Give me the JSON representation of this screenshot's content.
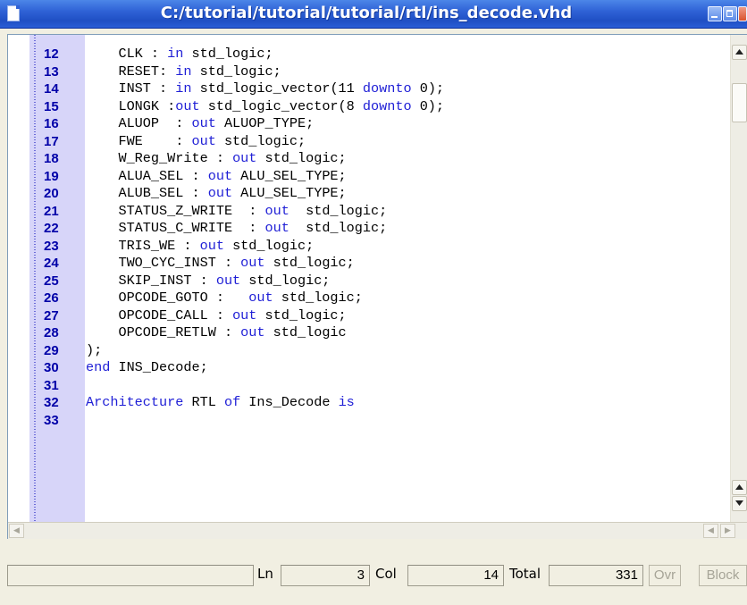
{
  "window": {
    "title": "C:/tutorial/tutorial/tutorial/rtl/ins_decode.vhd"
  },
  "editor": {
    "lines": [
      {
        "n": "12",
        "code": [
          {
            "t": "    CLK : "
          },
          {
            "t": "in",
            "k": 1
          },
          {
            "t": " std_logic;"
          }
        ]
      },
      {
        "n": "13",
        "code": [
          {
            "t": "    RESET: "
          },
          {
            "t": "in",
            "k": 1
          },
          {
            "t": " std_logic;"
          }
        ]
      },
      {
        "n": "14",
        "code": [
          {
            "t": "    INST : "
          },
          {
            "t": "in",
            "k": 1
          },
          {
            "t": " std_logic_vector(11 "
          },
          {
            "t": "downto",
            "k": 1
          },
          {
            "t": " 0);"
          }
        ]
      },
      {
        "n": "15",
        "code": [
          {
            "t": "    LONGK :"
          },
          {
            "t": "out",
            "k": 1
          },
          {
            "t": " std_logic_vector(8 "
          },
          {
            "t": "downto",
            "k": 1
          },
          {
            "t": " 0);"
          }
        ]
      },
      {
        "n": "16",
        "code": [
          {
            "t": "    ALUOP  : "
          },
          {
            "t": "out",
            "k": 1
          },
          {
            "t": " ALUOP_TYPE;"
          }
        ]
      },
      {
        "n": "17",
        "code": [
          {
            "t": "    FWE    : "
          },
          {
            "t": "out",
            "k": 1
          },
          {
            "t": " std_logic;"
          }
        ]
      },
      {
        "n": "18",
        "code": [
          {
            "t": "    W_Reg_Write : "
          },
          {
            "t": "out",
            "k": 1
          },
          {
            "t": " std_logic;"
          }
        ]
      },
      {
        "n": "19",
        "code": [
          {
            "t": "    ALUA_SEL : "
          },
          {
            "t": "out",
            "k": 1
          },
          {
            "t": " ALU_SEL_TYPE;"
          }
        ]
      },
      {
        "n": "20",
        "code": [
          {
            "t": "    ALUB_SEL : "
          },
          {
            "t": "out",
            "k": 1
          },
          {
            "t": " ALU_SEL_TYPE;"
          }
        ]
      },
      {
        "n": "21",
        "code": [
          {
            "t": "    STATUS_Z_WRITE  : "
          },
          {
            "t": "out",
            "k": 1
          },
          {
            "t": "  std_logic;"
          }
        ]
      },
      {
        "n": "22",
        "code": [
          {
            "t": "    STATUS_C_WRITE  : "
          },
          {
            "t": "out",
            "k": 1
          },
          {
            "t": "  std_logic;"
          }
        ]
      },
      {
        "n": "23",
        "code": [
          {
            "t": "    TRIS_WE : "
          },
          {
            "t": "out",
            "k": 1
          },
          {
            "t": " std_logic;"
          }
        ]
      },
      {
        "n": "24",
        "code": [
          {
            "t": "    TWO_CYC_INST : "
          },
          {
            "t": "out",
            "k": 1
          },
          {
            "t": " std_logic;"
          }
        ]
      },
      {
        "n": "25",
        "code": [
          {
            "t": "    SKIP_INST : "
          },
          {
            "t": "out",
            "k": 1
          },
          {
            "t": " std_logic;"
          }
        ]
      },
      {
        "n": "26",
        "code": [
          {
            "t": "    OPCODE_GOTO :   "
          },
          {
            "t": "out",
            "k": 1
          },
          {
            "t": " std_logic;"
          }
        ]
      },
      {
        "n": "27",
        "code": [
          {
            "t": "    OPCODE_CALL : "
          },
          {
            "t": "out",
            "k": 1
          },
          {
            "t": " std_logic;"
          }
        ]
      },
      {
        "n": "28",
        "code": [
          {
            "t": "    OPCODE_RETLW : "
          },
          {
            "t": "out",
            "k": 1
          },
          {
            "t": " std_logic"
          }
        ]
      },
      {
        "n": "29",
        "code": [
          {
            "t": ");"
          }
        ]
      },
      {
        "n": "30",
        "code": [
          {
            "t": "end",
            "k": 1
          },
          {
            "t": " INS_Decode;"
          }
        ]
      },
      {
        "n": "31",
        "code": []
      },
      {
        "n": "32",
        "code": [
          {
            "t": "Architecture",
            "k": 1
          },
          {
            "t": " RTL "
          },
          {
            "t": "of",
            "k": 1
          },
          {
            "t": " Ins_Decode "
          },
          {
            "t": "is",
            "k": 1
          }
        ]
      },
      {
        "n": "33",
        "code": []
      }
    ]
  },
  "statusbar": {
    "message": "",
    "ln_label": "Ln",
    "ln_value": "3",
    "col_label": "Col",
    "col_value": "14",
    "total_label": "Total",
    "total_value": "331",
    "ovr_label": "Ovr",
    "block_label": "Block"
  },
  "colors": {
    "keyword": "#1f1fd6",
    "line_number": "#0000a8",
    "gutter": "#d7d5f9",
    "titlebar": "#2f62d6"
  }
}
